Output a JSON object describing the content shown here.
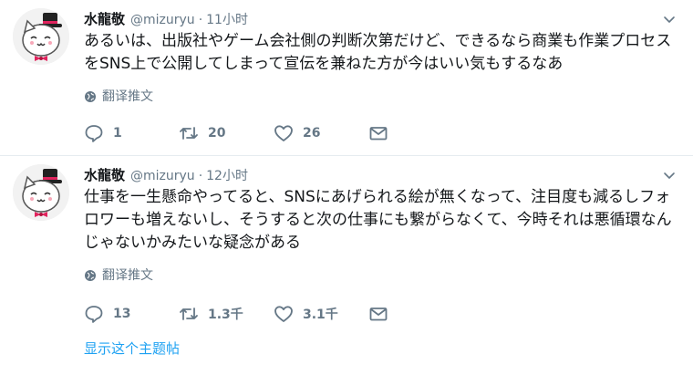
{
  "tweets": [
    {
      "name": "水龍敬",
      "handle": "@mizuryu",
      "separator": "·",
      "time": "11小时",
      "text": "あるいは、出版社やゲーム会社側の判断次第だけど、できるなら商業も作業プロセスをSNS上で公開してしまって宣伝を兼ねた方が今はいい気もするなあ",
      "translate": "翻译推文",
      "replies": "1",
      "retweets": "20",
      "likes": "26"
    },
    {
      "name": "水龍敬",
      "handle": "@mizuryu",
      "separator": "·",
      "time": "12小时",
      "text": "仕事を一生懸命やってると、SNSにあげられる絵が無くなって、注目度も減るしフォロワーも増えないし、そうすると次の仕事にも繋がらなくて、今時それは悪循環なんじゃないかみたいな疑念がある",
      "translate": "翻译推文",
      "replies": "13",
      "retweets": "1.3千",
      "likes": "3.1千"
    }
  ],
  "thread_link": "显示这个主题帖",
  "colors": {
    "text": "#14171a",
    "muted": "#657786",
    "link": "#1da1f2",
    "divider": "#e6ecf0",
    "hat_band": "#e0245e",
    "bow": "#e0245e"
  },
  "icons": [
    "avatar-cat-hat",
    "chevron-down-icon",
    "globe-icon",
    "reply-icon",
    "retweet-icon",
    "like-icon",
    "message-icon"
  ]
}
